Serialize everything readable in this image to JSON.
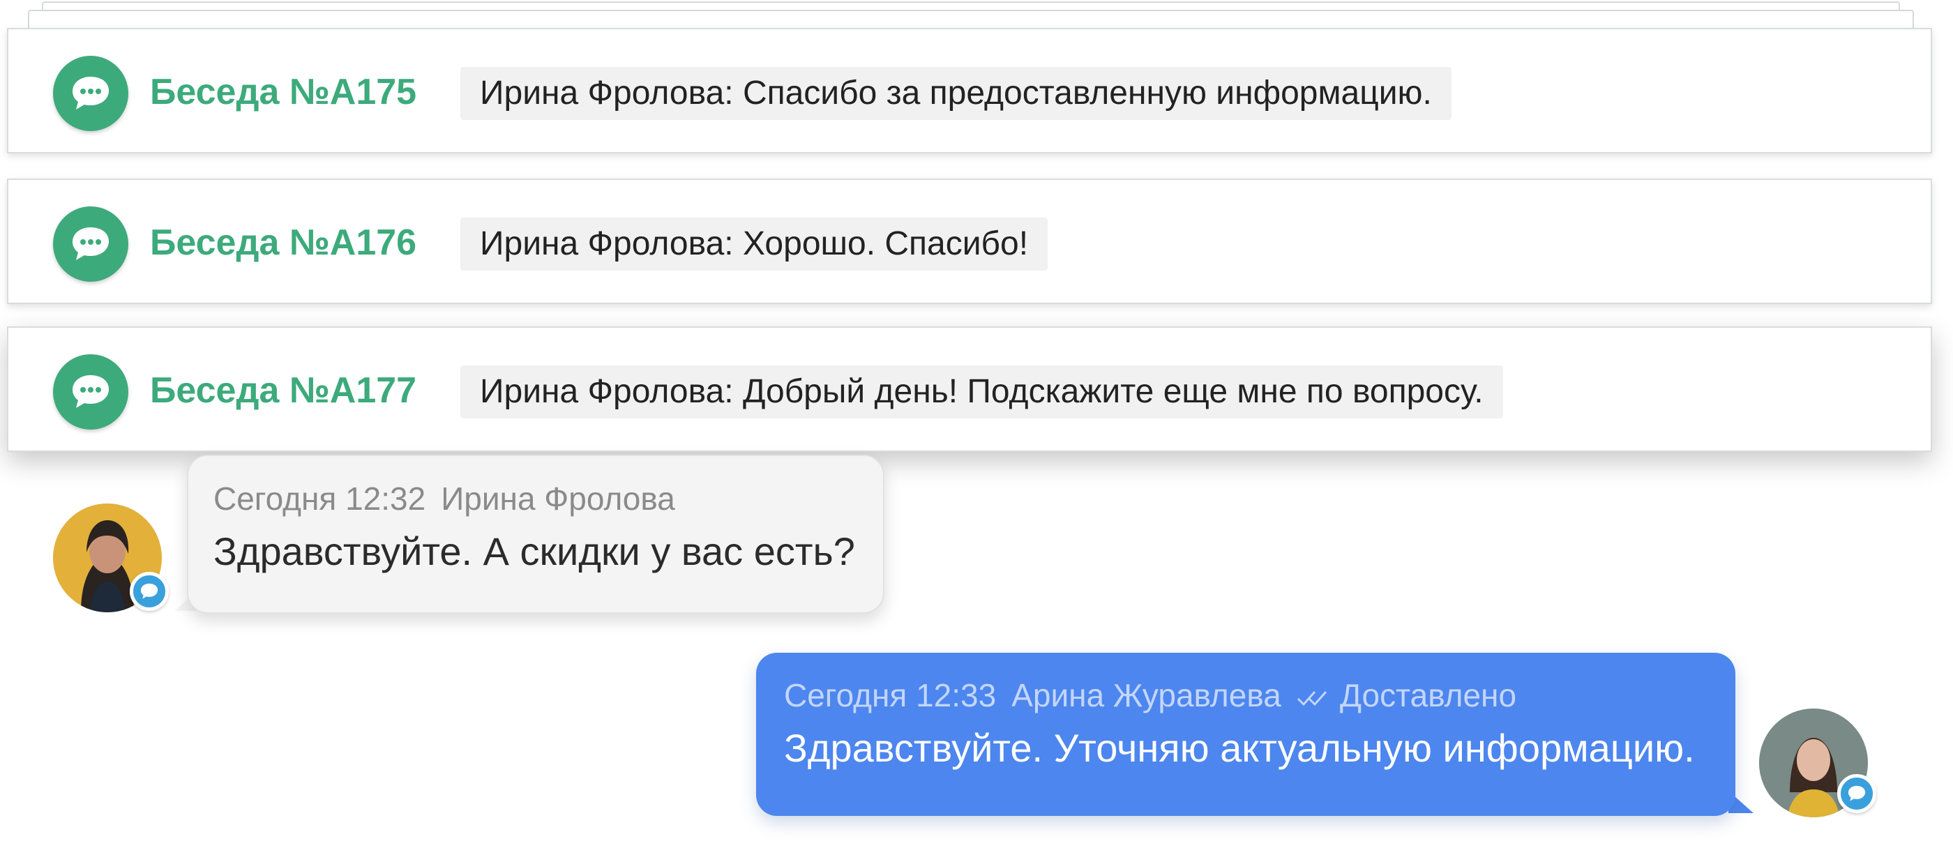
{
  "conversations": [
    {
      "title": "Беседа №А175",
      "preview": "Ирина Фролова: Спасибо за предоставленную информацию."
    },
    {
      "title": "Беседа №А176",
      "preview": "Ирина Фролова: Хорошо. Спасибо!"
    },
    {
      "title": "Беседа №А177",
      "preview": "Ирина Фролова: Добрый день! Подскажите еще мне по вопросу."
    }
  ],
  "messages": {
    "incoming": {
      "time": "Сегодня 12:32",
      "author": "Ирина Фролова",
      "text": "Здравствуйте. А скидки у вас есть?"
    },
    "outgoing": {
      "time": "Сегодня 12:33",
      "author": "Арина Журавлева",
      "status_icon": "double-check-icon",
      "status": "Доставлено",
      "text": "Здравствуйте. Уточняю актуальную информацию."
    }
  },
  "colors": {
    "accent_green": "#3daa7c",
    "outgoing_bubble": "#4d86ee",
    "incoming_bubble": "#f4f4f4",
    "badge_blue": "#3aa0dc"
  }
}
